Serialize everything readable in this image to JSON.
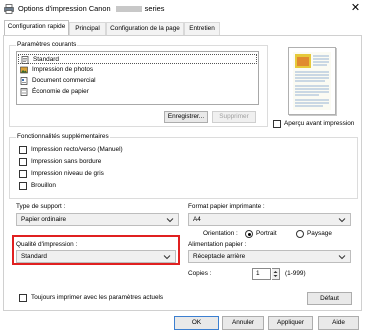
{
  "window": {
    "title": "Options d'impression Canon ",
    "title_suffix": "series",
    "close_glyph": "✕",
    "icon": "printer-icon"
  },
  "tabs": [
    {
      "label": "Configuration rapide",
      "active": true
    },
    {
      "label": "Principal",
      "active": false
    },
    {
      "label": "Configuration de la page",
      "active": false
    },
    {
      "label": "Entretien",
      "active": false
    }
  ],
  "current_settings": {
    "group_label": "Paramètres courants",
    "items": [
      {
        "label": "Standard",
        "icon": "standard-doc-icon",
        "selected": true
      },
      {
        "label": "Impression de photos",
        "icon": "photo-icon",
        "selected": false
      },
      {
        "label": "Document commercial",
        "icon": "business-doc-icon",
        "selected": false
      },
      {
        "label": "Économie de papier",
        "icon": "paper-saving-icon",
        "selected": false
      }
    ],
    "save_button": "Enregistrer...",
    "delete_button": "Supprimer"
  },
  "preview": {
    "checkbox_label": "Aperçu avant impression",
    "checked": false
  },
  "extra_features": {
    "group_label": "Fonctionnalités supplémentaires",
    "items": [
      {
        "label": "Impression recto/verso (Manuel)",
        "checked": false
      },
      {
        "label": "Impression sans bordure",
        "checked": false
      },
      {
        "label": "Impression niveau de gris",
        "checked": false
      },
      {
        "label": "Brouillon",
        "checked": false
      }
    ]
  },
  "media_type": {
    "label": "Type de support :",
    "value": "Papier ordinaire"
  },
  "paper_size": {
    "label": "Format papier imprimante :",
    "value": "A4"
  },
  "orientation": {
    "label": "Orientation :",
    "options": [
      {
        "label": "Portrait",
        "selected": true
      },
      {
        "label": "Paysage",
        "selected": false
      }
    ]
  },
  "print_quality": {
    "label": "Qualité d'impression :",
    "value": "Standard"
  },
  "paper_source": {
    "label": "Alimentation papier :",
    "value": "Réceptacle arrière"
  },
  "copies": {
    "label": "Copies :",
    "value": "1",
    "range": "(1-999)"
  },
  "always_print": {
    "label": "Toujours imprimer avec les paramètres actuels",
    "checked": false
  },
  "default_button": "Défaut",
  "footer": {
    "ok": "OK",
    "cancel": "Annuler",
    "apply": "Appliquer",
    "help": "Aide"
  },
  "colors": {
    "highlight": "#e02020",
    "panel_border": "#d0d0d0"
  }
}
